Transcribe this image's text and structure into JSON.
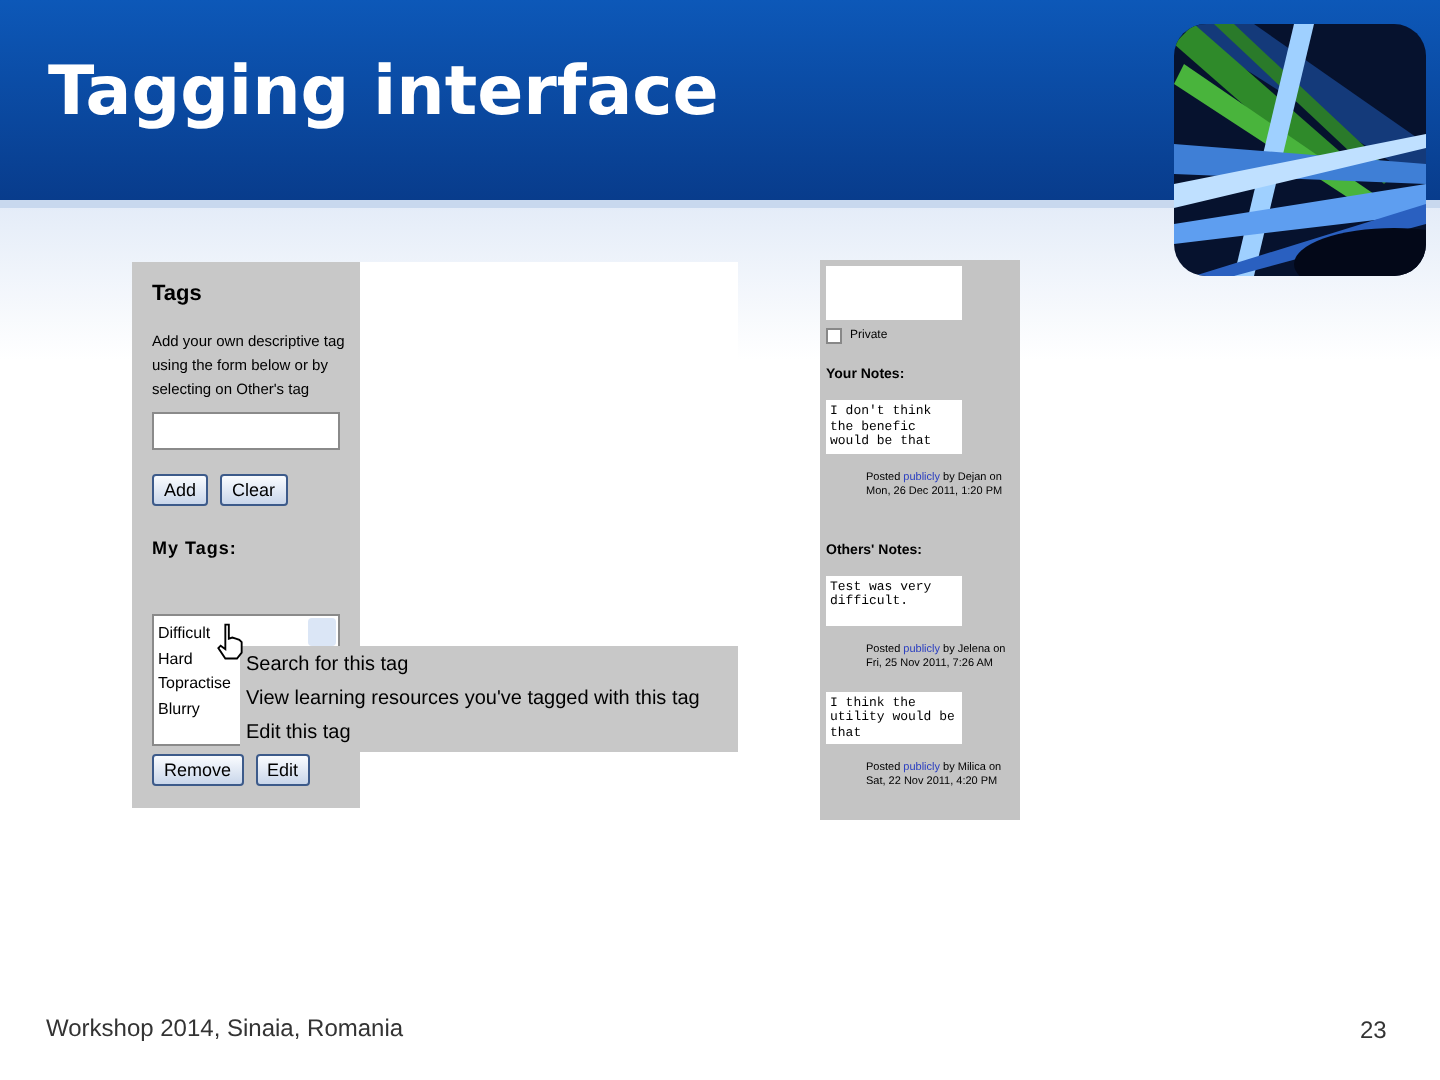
{
  "slide": {
    "title": "Tagging interface",
    "footer": "Workshop 2014, Sinaia, Romania",
    "page_number": "23"
  },
  "tags_panel": {
    "heading": "Tags",
    "description": "Add your own descriptive tag using the form below or by selecting on Other's tag",
    "form_buttons": [
      "Add",
      "Clear"
    ],
    "my_tags_label": "My Tags:",
    "my_tags": [
      "Difficult",
      "Hard",
      "Topractise",
      "Blurry"
    ],
    "list_buttons": [
      "Remove",
      "Edit"
    ],
    "context_menu": [
      "Search for this tag",
      "View learning resources you've tagged with this tag",
      "Edit this tag"
    ]
  },
  "notes_panel": {
    "private": {
      "label": "Private",
      "checked": false
    },
    "your_notes_label": "Your Notes:",
    "your_notes": [
      {
        "text": "I don't think the benefic would be that",
        "posted": "Posted",
        "link": "publicly",
        "byline": "by Dejan on Mon, 26 Dec 2011, 1:20 PM"
      }
    ],
    "others_notes_label": "Others' Notes:",
    "others_notes": [
      {
        "text": "Test was very difficult.",
        "posted": "Posted",
        "link": "publicly",
        "byline": "by Jelena on Fri, 25 Nov 2011, 7:26 AM"
      },
      {
        "text": "I think the utility would be that",
        "posted": "Posted",
        "link": "publicly",
        "byline": "by Milica on Sat, 22 Nov 2011, 4:20 PM"
      }
    ]
  }
}
